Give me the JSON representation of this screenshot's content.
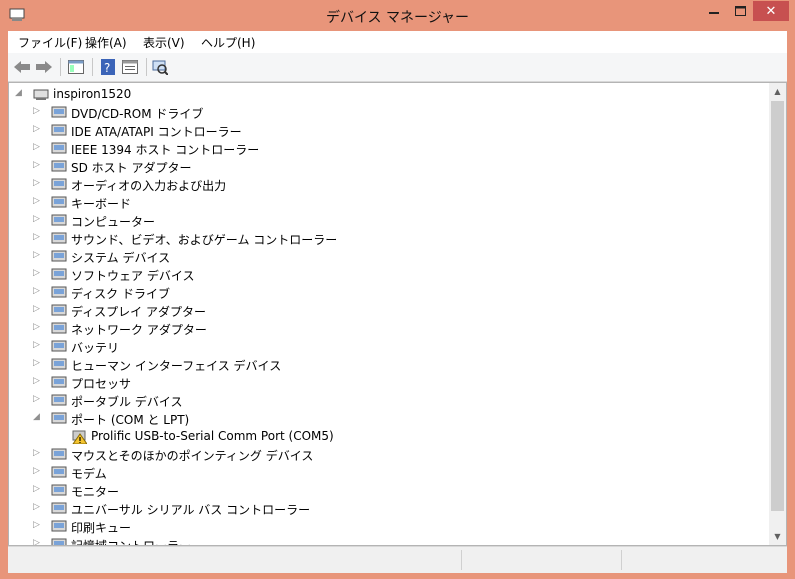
{
  "window": {
    "title": "デバイス マネージャー",
    "close_glyph": "✕"
  },
  "menubar": {
    "items": [
      "ファイル(F)",
      "操作(A)",
      "表示(V)",
      "ヘルプ(H)"
    ]
  },
  "toolbar": {
    "buttons": [
      "back-icon",
      "forward-icon",
      "properties-view-icon",
      "help-icon",
      "update-driver-icon",
      "scan-hardware-icon"
    ]
  },
  "tree": {
    "root": "inspiron1520",
    "categories": [
      {
        "label": "DVD/CD-ROM ドライブ",
        "icon": "dvd-drive-icon",
        "expanded": false
      },
      {
        "label": "IDE ATA/ATAPI コントローラー",
        "icon": "ide-controller-icon",
        "expanded": false
      },
      {
        "label": "IEEE 1394 ホスト コントローラー",
        "icon": "ieee1394-icon",
        "expanded": false
      },
      {
        "label": "SD ホスト アダプター",
        "icon": "sd-host-icon",
        "expanded": false
      },
      {
        "label": "オーディオの入力および出力",
        "icon": "audio-io-icon",
        "expanded": false
      },
      {
        "label": "キーボード",
        "icon": "keyboard-icon",
        "expanded": false
      },
      {
        "label": "コンピューター",
        "icon": "computer-icon",
        "expanded": false
      },
      {
        "label": "サウンド、ビデオ、およびゲーム コントローラー",
        "icon": "sound-icon",
        "expanded": false
      },
      {
        "label": "システム デバイス",
        "icon": "system-device-icon",
        "expanded": false
      },
      {
        "label": "ソフトウェア デバイス",
        "icon": "software-device-icon",
        "expanded": false
      },
      {
        "label": "ディスク ドライブ",
        "icon": "disk-drive-icon",
        "expanded": false
      },
      {
        "label": "ディスプレイ アダプター",
        "icon": "display-adapter-icon",
        "expanded": false
      },
      {
        "label": "ネットワーク アダプター",
        "icon": "network-adapter-icon",
        "expanded": false
      },
      {
        "label": "バッテリ",
        "icon": "battery-icon",
        "expanded": false
      },
      {
        "label": "ヒューマン インターフェイス デバイス",
        "icon": "hid-icon",
        "expanded": false
      },
      {
        "label": "プロセッサ",
        "icon": "processor-icon",
        "expanded": false
      },
      {
        "label": "ポータブル デバイス",
        "icon": "portable-device-icon",
        "expanded": false
      },
      {
        "label": "ポート (COM と LPT)",
        "icon": "port-icon",
        "expanded": true,
        "children": [
          {
            "label": "Prolific USB-to-Serial Comm Port (COM5)",
            "icon": "warning-port-icon"
          }
        ]
      },
      {
        "label": "マウスとそのほかのポインティング デバイス",
        "icon": "mouse-icon",
        "expanded": false
      },
      {
        "label": "モデム",
        "icon": "modem-icon",
        "expanded": false
      },
      {
        "label": "モニター",
        "icon": "monitor-icon",
        "expanded": false
      },
      {
        "label": "ユニバーサル シリアル バス コントローラー",
        "icon": "usb-icon",
        "expanded": false
      },
      {
        "label": "印刷キュー",
        "icon": "printer-icon",
        "expanded": false
      },
      {
        "label": "記憶域コントローラー",
        "icon": "storage-controller-icon",
        "expanded": false
      }
    ]
  },
  "colors": {
    "frame": "#e8957a",
    "close": "#c75050",
    "warning": "#f4c430"
  }
}
